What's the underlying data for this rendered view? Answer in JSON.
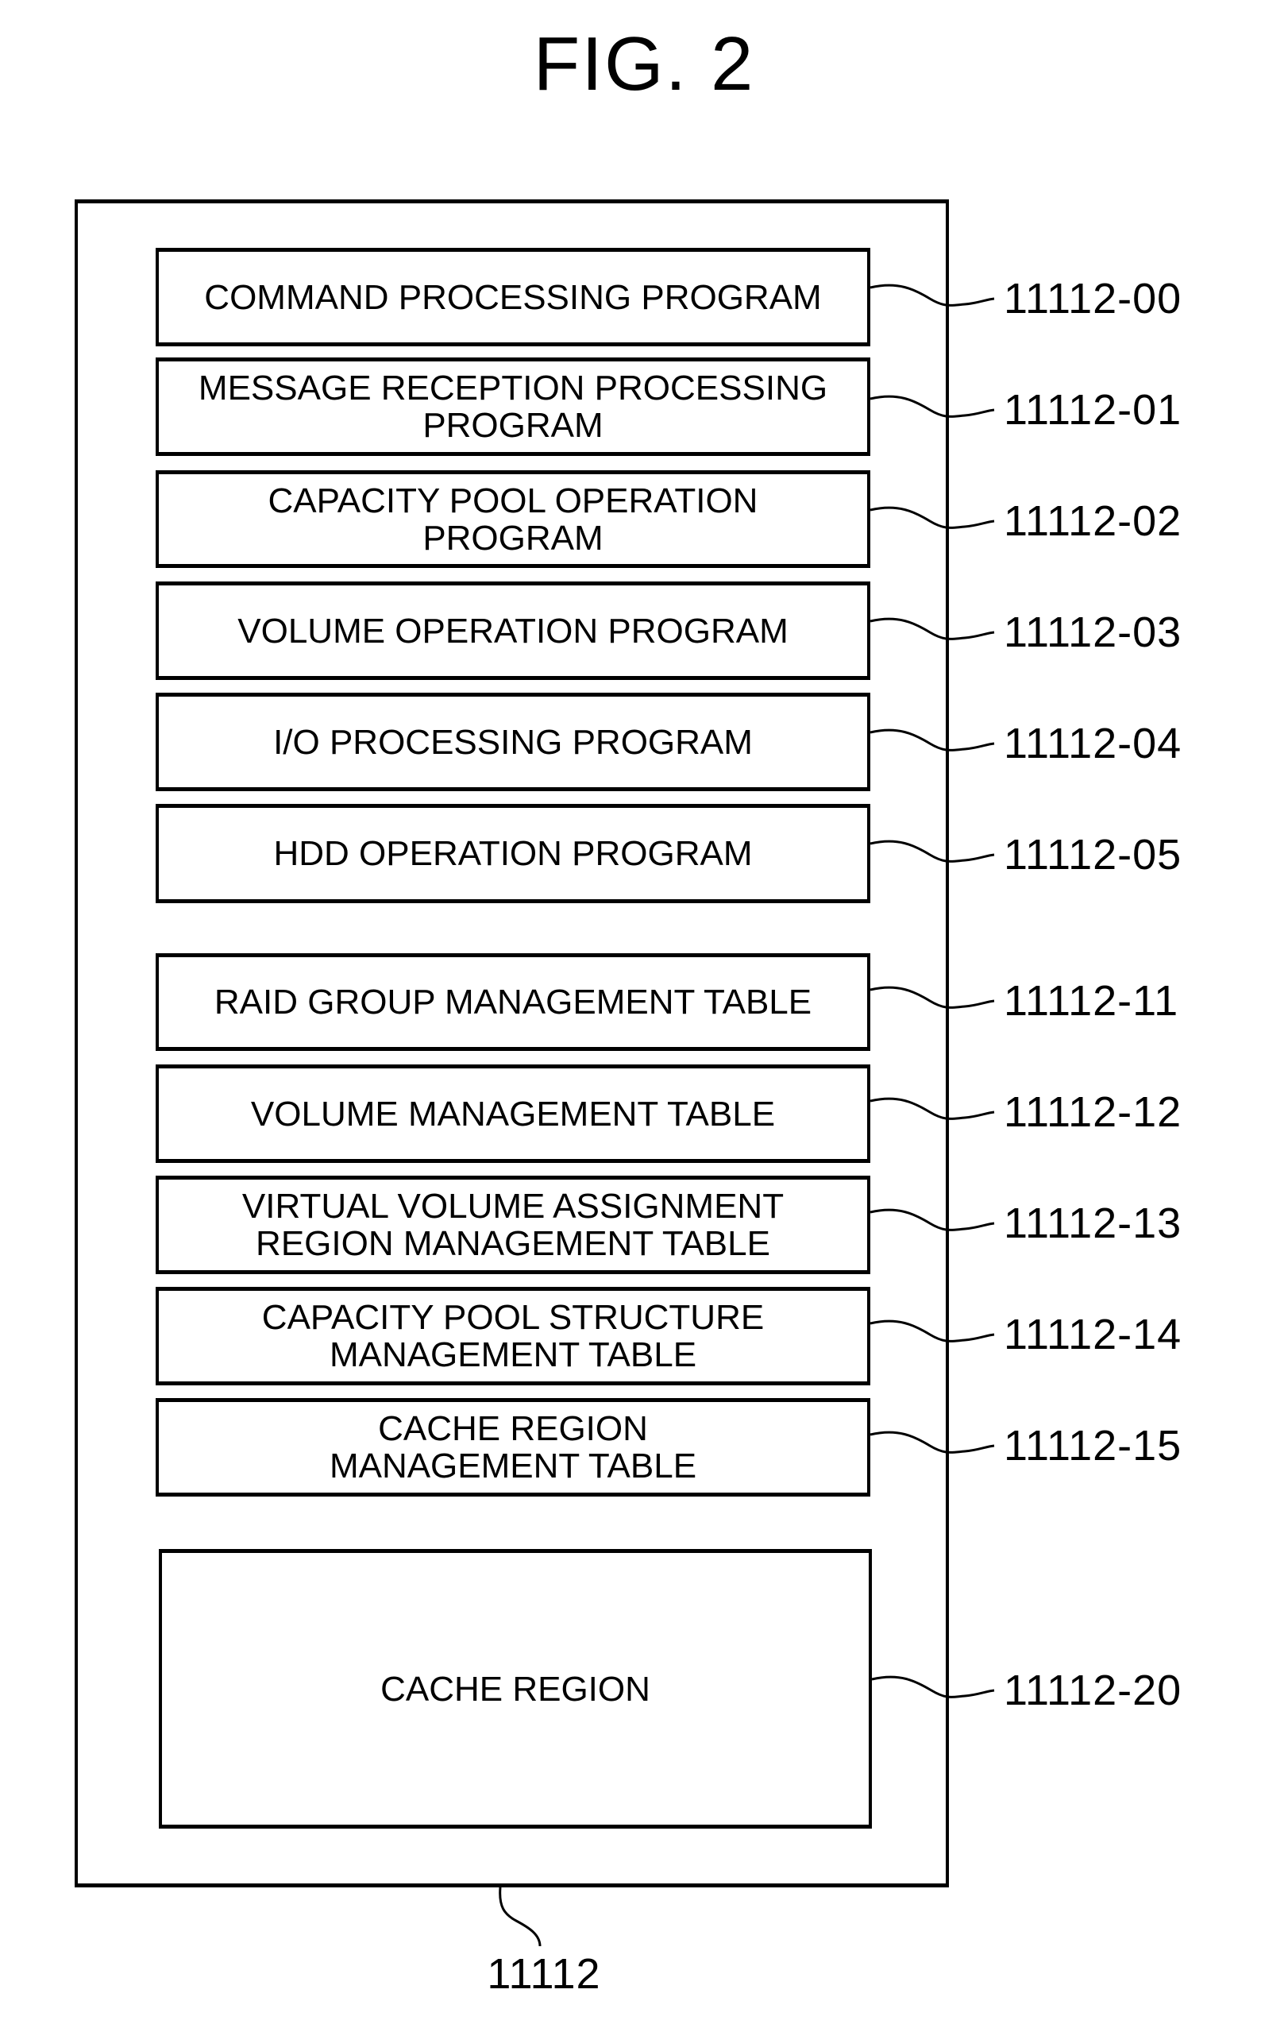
{
  "figure": {
    "title": "FIG. 2",
    "container_ref": "11112"
  },
  "blocks": [
    {
      "label": "COMMAND PROCESSING PROGRAM",
      "ref": "11112-00",
      "group": "programs"
    },
    {
      "label": "MESSAGE RECEPTION PROCESSING\nPROGRAM",
      "ref": "11112-01",
      "group": "programs"
    },
    {
      "label": "CAPACITY POOL OPERATION\nPROGRAM",
      "ref": "11112-02",
      "group": "programs"
    },
    {
      "label": "VOLUME OPERATION PROGRAM",
      "ref": "11112-03",
      "group": "programs"
    },
    {
      "label": "I/O PROCESSING PROGRAM",
      "ref": "11112-04",
      "group": "programs"
    },
    {
      "label": "HDD OPERATION PROGRAM",
      "ref": "11112-05",
      "group": "programs"
    },
    {
      "label": "RAID GROUP MANAGEMENT TABLE",
      "ref": "11112-11",
      "group": "tables"
    },
    {
      "label": "VOLUME MANAGEMENT TABLE",
      "ref": "11112-12",
      "group": "tables"
    },
    {
      "label": "VIRTUAL VOLUME ASSIGNMENT\nREGION MANAGEMENT TABLE",
      "ref": "11112-13",
      "group": "tables"
    },
    {
      "label": "CAPACITY POOL STRUCTURE\nMANAGEMENT TABLE",
      "ref": "11112-14",
      "group": "tables"
    },
    {
      "label": "CACHE REGION\nMANAGEMENT TABLE",
      "ref": "11112-15",
      "group": "tables"
    },
    {
      "label": "CACHE REGION",
      "ref": "11112-20",
      "group": "cache"
    }
  ]
}
